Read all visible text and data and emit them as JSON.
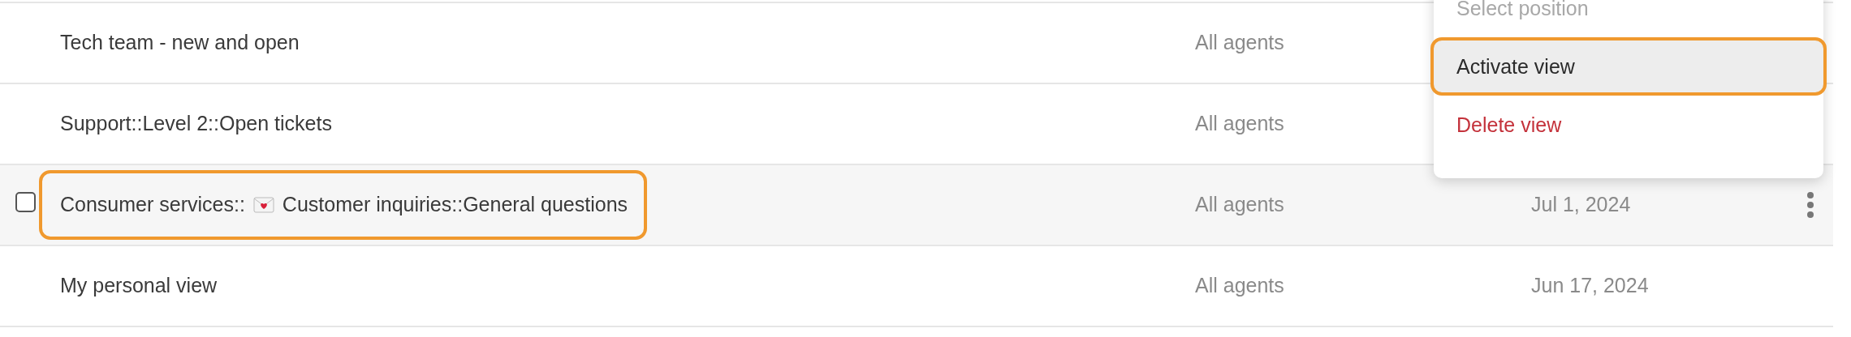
{
  "rows": [
    {
      "title_parts": [
        "Tech team - new and open"
      ],
      "audience": "All agents",
      "hovered": false,
      "highlighted": false
    },
    {
      "title_parts": [
        "Support::Level 2::Open tickets"
      ],
      "audience": "All agents",
      "hovered": false,
      "highlighted": false
    },
    {
      "title_parts": [
        "Consumer services::",
        "Customer inquiries::General questions"
      ],
      "has_icon": true,
      "audience": "All agents",
      "date": "Jul 1, 2024",
      "hovered": true,
      "checked": false,
      "highlighted": true
    },
    {
      "title_parts": [
        "My personal view"
      ],
      "audience": "All agents",
      "date": "Jun 17, 2024",
      "hovered": false,
      "highlighted": false
    }
  ],
  "menu": {
    "items": [
      {
        "label": "Select position",
        "kind": "normal",
        "disabled": true,
        "highlighted": false
      },
      {
        "label": "Activate view",
        "kind": "normal",
        "disabled": false,
        "highlighted": true
      },
      {
        "label": "Delete view",
        "kind": "danger",
        "disabled": false,
        "highlighted": false
      }
    ]
  }
}
